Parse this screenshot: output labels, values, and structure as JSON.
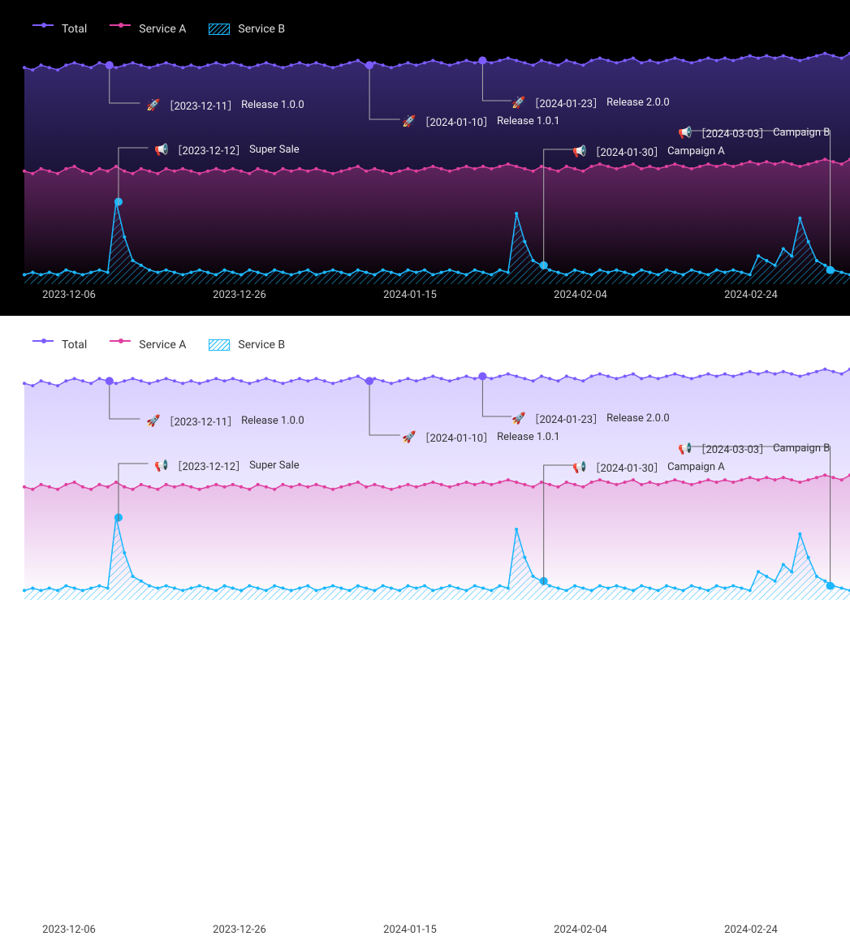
{
  "legend": {
    "total": "Total",
    "serviceA": "Service A",
    "serviceB": "Service B"
  },
  "xaxis_ticks": [
    "2023-12-06",
    "2023-12-26",
    "2024-01-15",
    "2024-02-04",
    "2024-02-24"
  ],
  "annotations": {
    "releases": [
      {
        "date": "2023-12-11",
        "label": "Release 1.0.0",
        "series": "total",
        "x": 103,
        "labelX": 150,
        "labelY": 60
      },
      {
        "date": "2024-01-10",
        "label": "Release 1.0.1",
        "series": "total",
        "x": 418,
        "labelX": 465,
        "labelY": 80
      },
      {
        "date": "2024-01-23",
        "label": "Release 2.0.0",
        "series": "total",
        "x": 555,
        "labelX": 600,
        "labelY": 57
      }
    ],
    "campaigns": [
      {
        "date": "2023-12-12",
        "label": "Super Sale",
        "series": "b",
        "x": 114,
        "labelX": 160,
        "labelY": 115
      },
      {
        "date": "2024-01-30",
        "label": "Campaign A",
        "series": "b",
        "x": 629,
        "labelX": 675,
        "labelY": 117
      },
      {
        "date": "2024-03-03",
        "label": "Campaign B",
        "series": "b",
        "x": 976,
        "labelX": 805,
        "labelY": 94
      }
    ]
  },
  "colors": {
    "total": "#7c5cff",
    "serviceA": "#e040a0",
    "serviceB": "#1cb8ff"
  },
  "chart_data": [
    {
      "type": "line",
      "theme": "dark",
      "x_start": "2023-12-01",
      "x_end": "2024-03-10",
      "x_interval": "1d",
      "series": [
        {
          "name": "Total",
          "style": "line+area-gradient",
          "color": "#7c5cff",
          "values": [
            92,
            91,
            93,
            92,
            91,
            93,
            94,
            93,
            92,
            94,
            93,
            92,
            93,
            94,
            93,
            92,
            93,
            94,
            93,
            92,
            93,
            92,
            93,
            94,
            93,
            94,
            93,
            92,
            93,
            94,
            93,
            92,
            93,
            94,
            93,
            94,
            93,
            92,
            93,
            94,
            95,
            93,
            94,
            93,
            92,
            93,
            94,
            93,
            94,
            95,
            94,
            93,
            94,
            95,
            94,
            95,
            94,
            95,
            96,
            95,
            94,
            93,
            95,
            94,
            93,
            95,
            94,
            93,
            95,
            96,
            95,
            94,
            95,
            96,
            94,
            95,
            94,
            95,
            96,
            95,
            94,
            95,
            96,
            95,
            96,
            95,
            96,
            97,
            96,
            97,
            96,
            97,
            96,
            95,
            96,
            97,
            98,
            97,
            96,
            98
          ]
        },
        {
          "name": "Service A",
          "style": "line+area-gradient",
          "color": "#e040a0",
          "values": [
            48,
            47,
            49,
            48,
            47,
            49,
            50,
            48,
            47,
            49,
            48,
            50,
            48,
            47,
            49,
            48,
            47,
            49,
            48,
            49,
            48,
            47,
            48,
            49,
            48,
            49,
            48,
            47,
            49,
            48,
            47,
            49,
            48,
            49,
            48,
            49,
            48,
            47,
            48,
            49,
            50,
            48,
            49,
            48,
            47,
            48,
            49,
            48,
            49,
            50,
            49,
            48,
            49,
            50,
            49,
            50,
            49,
            50,
            51,
            50,
            49,
            48,
            50,
            49,
            48,
            50,
            49,
            48,
            50,
            51,
            50,
            49,
            50,
            51,
            49,
            50,
            49,
            50,
            51,
            50,
            49,
            50,
            51,
            50,
            51,
            50,
            51,
            52,
            51,
            52,
            51,
            52,
            51,
            50,
            51,
            52,
            53,
            52,
            51,
            53
          ]
        },
        {
          "name": "Service B",
          "style": "area-hatch",
          "color": "#1cb8ff",
          "values": [
            4,
            5,
            4,
            5,
            4,
            6,
            5,
            4,
            5,
            6,
            5,
            35,
            20,
            10,
            8,
            6,
            5,
            6,
            5,
            4,
            5,
            6,
            5,
            4,
            6,
            5,
            4,
            6,
            5,
            4,
            6,
            5,
            4,
            5,
            6,
            4,
            5,
            6,
            5,
            4,
            6,
            5,
            4,
            6,
            5,
            4,
            6,
            5,
            6,
            4,
            5,
            6,
            5,
            4,
            6,
            5,
            4,
            6,
            5,
            30,
            18,
            10,
            8,
            6,
            5,
            4,
            6,
            5,
            4,
            6,
            5,
            6,
            5,
            4,
            6,
            5,
            4,
            6,
            5,
            4,
            6,
            5,
            4,
            6,
            5,
            6,
            5,
            4,
            12,
            10,
            8,
            15,
            12,
            28,
            18,
            10,
            8,
            6,
            5,
            4
          ]
        }
      ],
      "ylim": [
        0,
        100
      ],
      "annotations": [
        {
          "type": "release",
          "icon": "🚀",
          "date": "2023-12-11",
          "label": "Release 1.0.0",
          "series": "Total"
        },
        {
          "type": "release",
          "icon": "🚀",
          "date": "2024-01-10",
          "label": "Release 1.0.1",
          "series": "Total"
        },
        {
          "type": "release",
          "icon": "🚀",
          "date": "2024-01-23",
          "label": "Release 2.0.0",
          "series": "Total"
        },
        {
          "type": "campaign",
          "icon": "📢",
          "date": "2023-12-12",
          "label": "Super Sale",
          "series": "Service B"
        },
        {
          "type": "campaign",
          "icon": "📢",
          "date": "2024-01-30",
          "label": "Campaign A",
          "series": "Service B"
        },
        {
          "type": "campaign",
          "icon": "📢",
          "date": "2024-03-03",
          "label": "Campaign B",
          "series": "Service B"
        }
      ],
      "x_ticks": [
        "2023-12-06",
        "2023-12-26",
        "2024-01-15",
        "2024-02-04",
        "2024-02-24"
      ]
    },
    {
      "type": "line",
      "theme": "light",
      "note": "identical data to dark chart, rendered on light background",
      "x_start": "2023-12-01",
      "x_end": "2024-03-10",
      "series_ref": "same as first chart",
      "x_ticks": [
        "2023-12-06",
        "2023-12-26",
        "2024-01-15",
        "2024-02-04",
        "2024-02-24"
      ]
    }
  ]
}
